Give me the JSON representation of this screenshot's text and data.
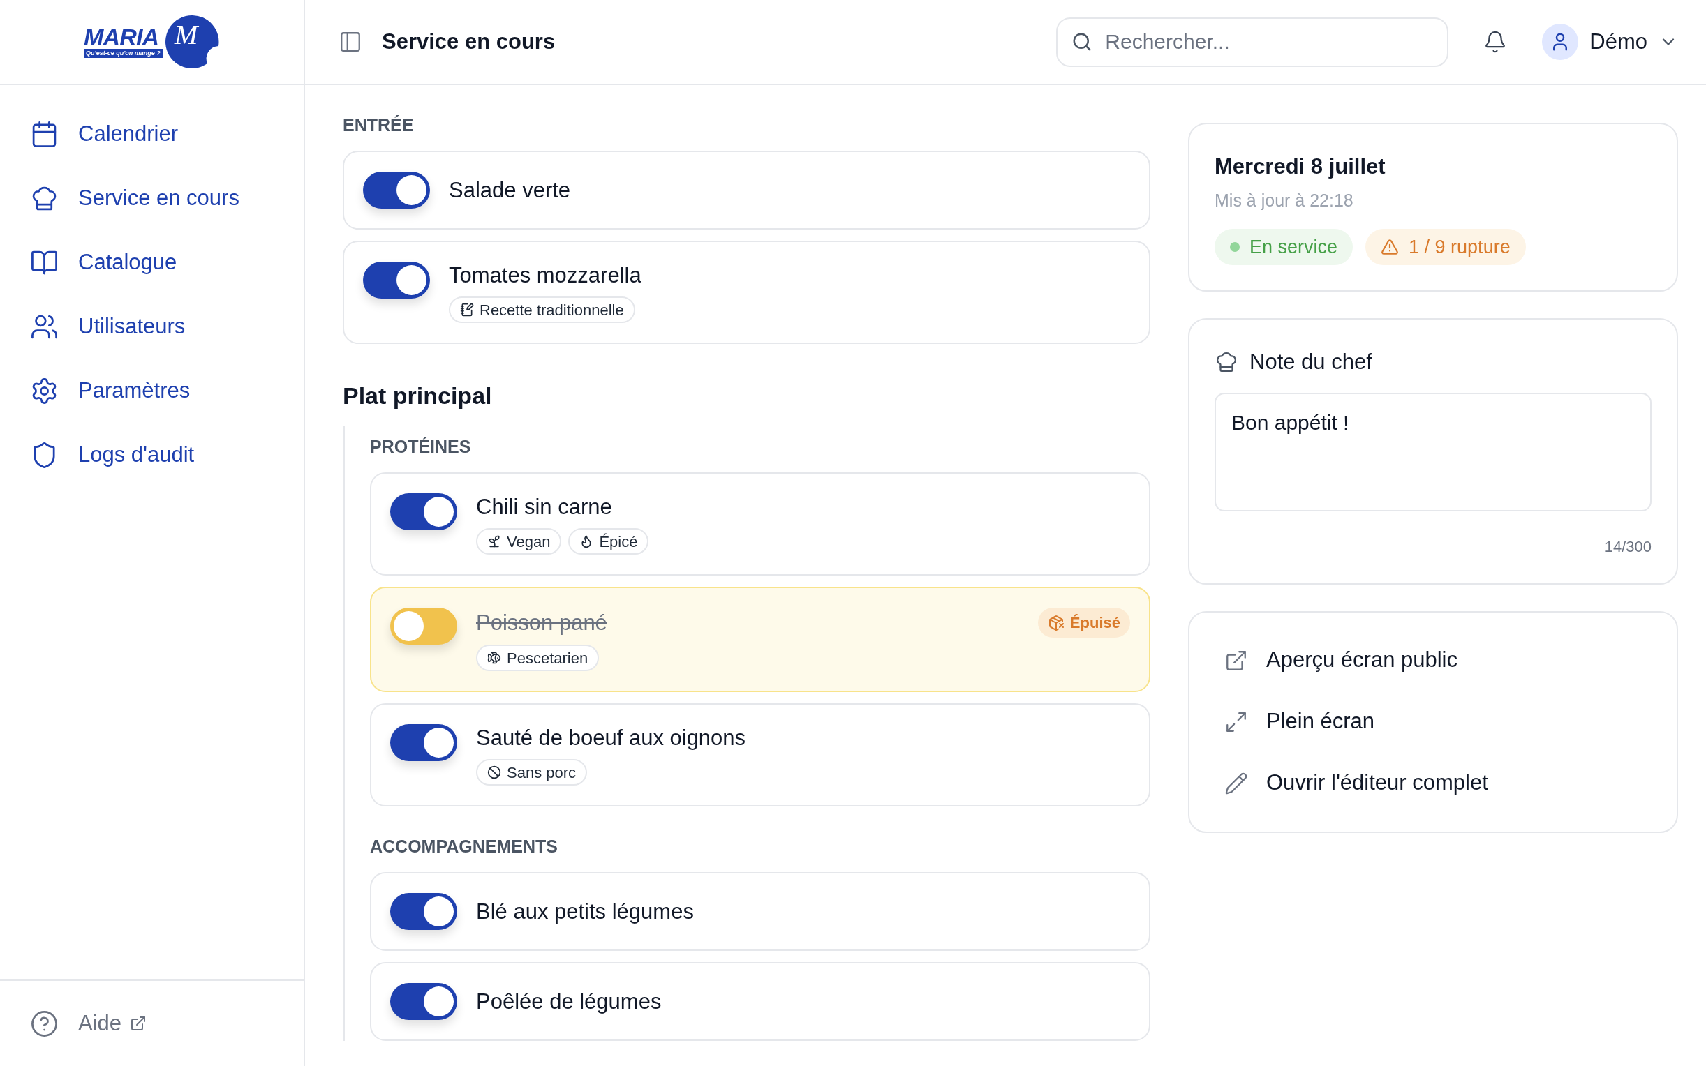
{
  "sidebar": {
    "logo": {
      "wordmark": "MARIA",
      "script": "M",
      "tagline": "Qu'est-ce qu'on mange ?"
    },
    "items": [
      {
        "label": "Calendrier",
        "kind": "calendar"
      },
      {
        "label": "Service en cours",
        "kind": "chef"
      },
      {
        "label": "Catalogue",
        "kind": "book"
      },
      {
        "label": "Utilisateurs",
        "kind": "users"
      },
      {
        "label": "Paramètres",
        "kind": "settings"
      },
      {
        "label": "Logs d'audit",
        "kind": "shield"
      }
    ],
    "help": {
      "label": "Aide"
    }
  },
  "header": {
    "title": "Service en cours",
    "search": {
      "placeholder": "Rechercher..."
    },
    "user": {
      "name": "Démo"
    }
  },
  "sections": [
    {
      "kind": "group",
      "title": "ENTRÉE",
      "items": [
        {
          "name": "Salade verte",
          "on": true
        },
        {
          "name": "Tomates mozzarella",
          "on": true,
          "tags": [
            {
              "label": "Recette traditionnelle",
              "kind": "recipe"
            }
          ]
        }
      ]
    },
    {
      "kind": "heading",
      "title": "Plat principal",
      "subsections": [
        {
          "title": "PROTÉINES",
          "items": [
            {
              "name": "Chili sin carne",
              "on": true,
              "tags": [
                {
                  "label": "Vegan",
                  "kind": "vegan"
                },
                {
                  "label": "Épicé",
                  "kind": "spicy"
                }
              ]
            },
            {
              "name": "Poisson pané",
              "on": false,
              "badge": "Épuisé",
              "tags": [
                {
                  "label": "Pescetarien",
                  "kind": "fish"
                }
              ]
            },
            {
              "name": "Sauté de boeuf aux oignons",
              "on": true,
              "tags": [
                {
                  "label": "Sans porc",
                  "kind": "ban"
                }
              ]
            }
          ]
        },
        {
          "title": "ACCOMPAGNEMENTS",
          "items": [
            {
              "name": "Blé aux petits légumes",
              "on": true
            },
            {
              "name": "Poêlée de légumes",
              "on": true
            }
          ]
        }
      ]
    }
  ],
  "status": {
    "date": "Mercredi 8 juillet",
    "updated": "Mis à jour à 22:18",
    "badges": [
      {
        "label": "En service",
        "kind": "success"
      },
      {
        "label": "1 / 9 rupture",
        "kind": "warning"
      }
    ]
  },
  "note": {
    "title": "Note du chef",
    "value": "Bon appétit !",
    "count": "14/300"
  },
  "actions": [
    {
      "label": "Aperçu écran public",
      "kind": "external"
    },
    {
      "label": "Plein écran",
      "kind": "fullscreen"
    },
    {
      "label": "Ouvrir l'éditeur complet",
      "kind": "edit"
    }
  ]
}
